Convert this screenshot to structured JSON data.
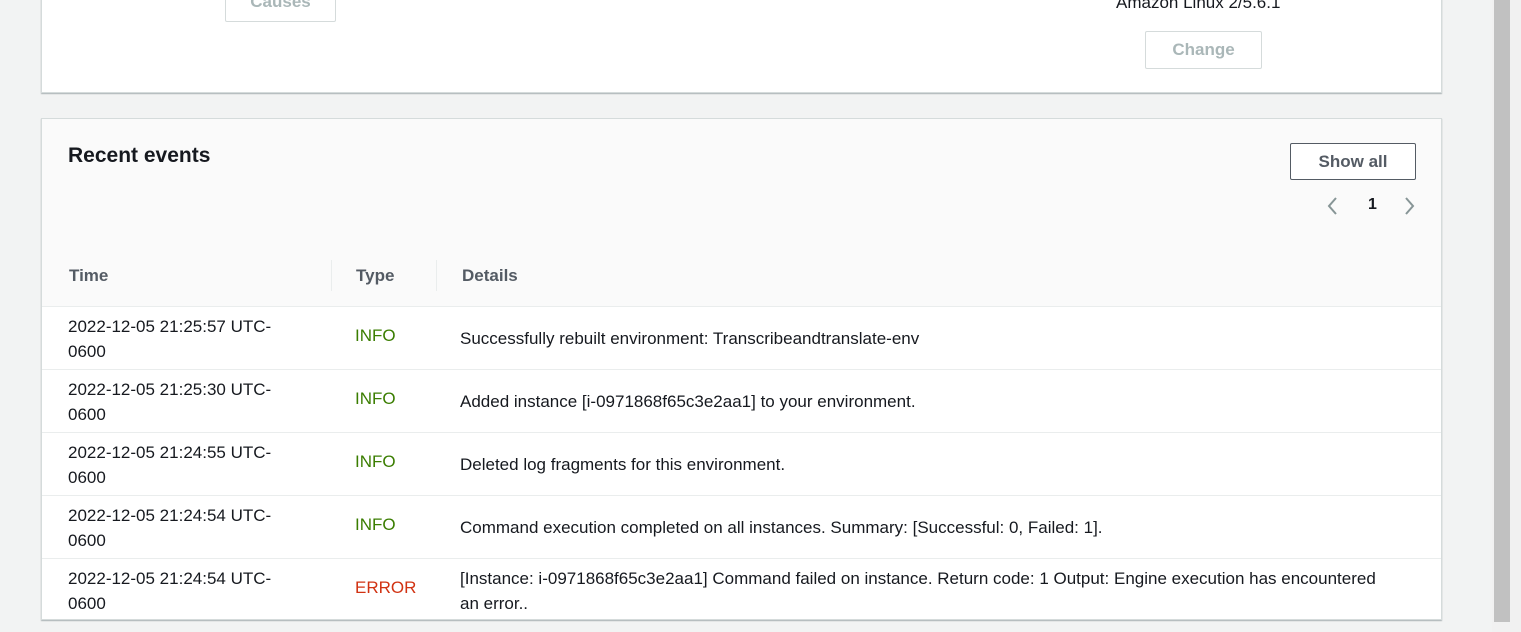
{
  "top_card": {
    "causes_label": "Causes",
    "platform_text": "Amazon Linux 2/5.6.1",
    "change_label": "Change"
  },
  "events": {
    "title": "Recent events",
    "show_all_label": "Show all",
    "pagination": {
      "current_page": "1"
    },
    "columns": {
      "time": "Time",
      "type": "Type",
      "details": "Details"
    },
    "rows": [
      {
        "time": "2022-12-05 21:25:57 UTC-0600",
        "type": "INFO",
        "details": "Successfully rebuilt environment: Transcribeandtranslate-env"
      },
      {
        "time": "2022-12-05 21:25:30 UTC-0600",
        "type": "INFO",
        "details": "Added instance [i-0971868f65c3e2aa1] to your environment."
      },
      {
        "time": "2022-12-05 21:24:55 UTC-0600",
        "type": "INFO",
        "details": "Deleted log fragments for this environment."
      },
      {
        "time": "2022-12-05 21:24:54 UTC-0600",
        "type": "INFO",
        "details": "Command execution completed on all instances. Summary: [Successful: 0, Failed: 1]."
      },
      {
        "time": "2022-12-05 21:24:54 UTC-0600",
        "type": "ERROR",
        "details": "[Instance: i-0971868f65c3e2aa1] Command failed on instance. Return code: 1 Output: Engine execution has encountered an error.."
      }
    ]
  },
  "colors": {
    "info": "#3a7d00",
    "error": "#d13212"
  },
  "icons": {
    "prev": "chevron-left-icon",
    "next": "chevron-right-icon"
  }
}
